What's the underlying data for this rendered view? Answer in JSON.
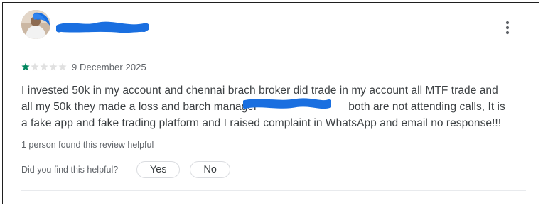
{
  "review": {
    "reviewer": {
      "name": "",
      "name_redacted": true,
      "avatar_icon": "avatar-icon"
    },
    "menu_icon": "more-vert-icon",
    "rating": {
      "stars": 1,
      "max_stars": 5,
      "filled_color": "#01875f",
      "empty_color": "#e0e0e0"
    },
    "date": "9 December 2025",
    "text_before_redaction": "I invested 50k in my account and chennai brach broker did trade in my account all MTF trade and all my 50k they made a loss and barch manager",
    "text_after_redaction": "both are not attending calls, It is a fake app and fake trading platform and I raised complaint in WhatsApp and email no response!!!",
    "redaction_color": "#1a6fe0",
    "helpful_count": "1 person found this review helpful",
    "feedback": {
      "question": "Did you find this helpful?",
      "yes_label": "Yes",
      "no_label": "No"
    }
  }
}
